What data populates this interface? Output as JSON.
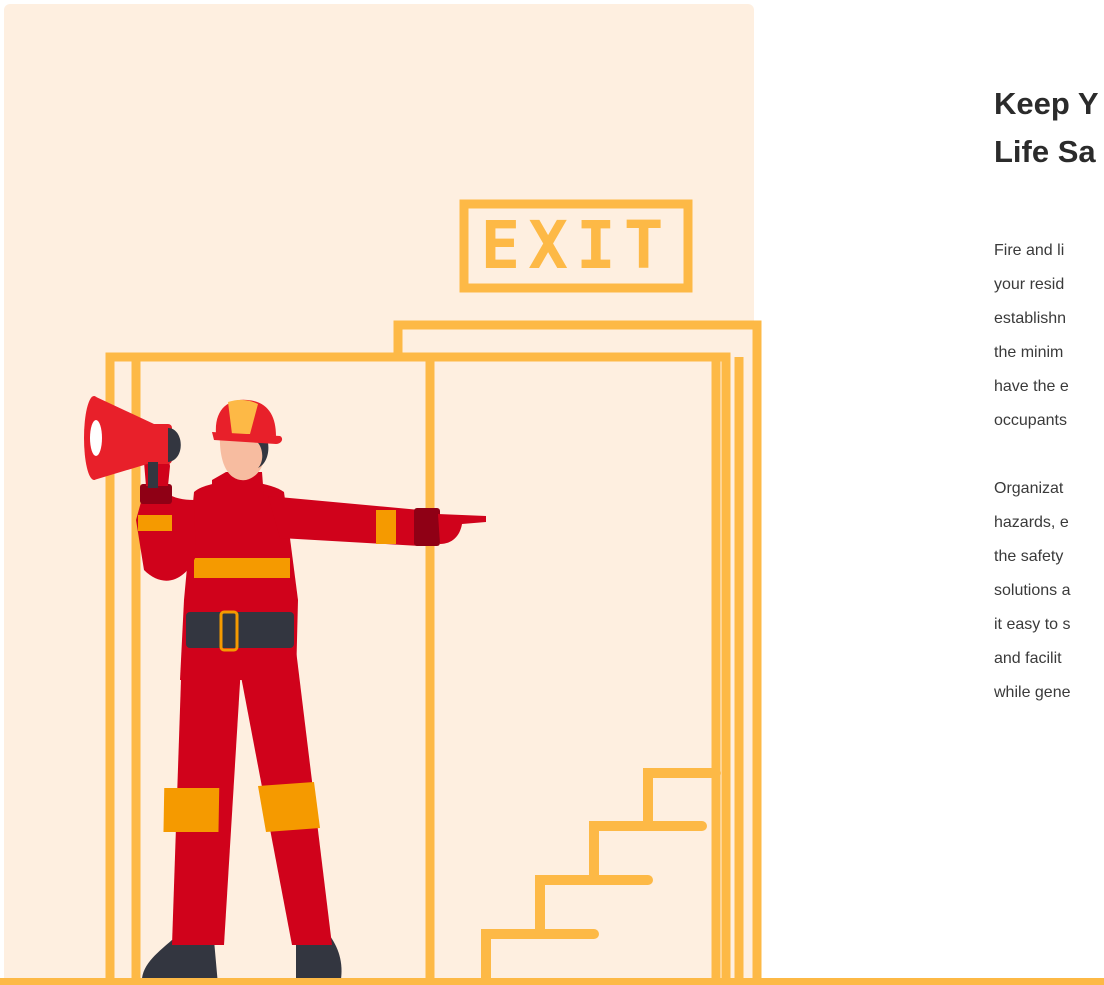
{
  "section": {
    "heading_lines": [
      "Keep Y",
      "Life Sa"
    ],
    "paragraph_1_lines": [
      "Fire and li",
      "your resid",
      "establishn",
      "the minim",
      "have the e",
      "occupants"
    ],
    "paragraph_2_lines": [
      "Organizat",
      "hazards, e",
      "the safety",
      "solutions a",
      "it easy to s",
      "and facilit",
      "while gene"
    ]
  },
  "illustration": {
    "sign_text": "EXIT",
    "colors": {
      "panel_background": "#FEEFE0",
      "frame_orange": "#FDB946",
      "sign_orange": "#FDB946",
      "suit_red": "#D0021B",
      "suit_stripe": "#F59A00",
      "helmet_red": "#E8202A",
      "helmet_stripe": "#FDB946",
      "skin": "#F7BCA0",
      "belt_boots": "#333333",
      "cuff_dark_red": "#8F0015"
    }
  }
}
